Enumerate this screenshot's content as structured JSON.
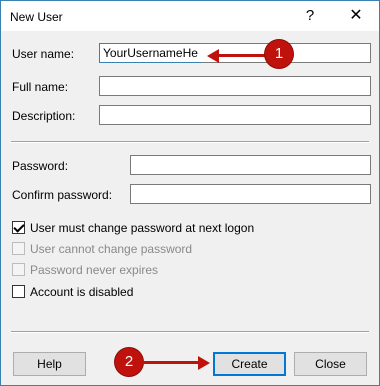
{
  "window": {
    "title": "New User",
    "help_glyph": "?",
    "close_glyph": "✕"
  },
  "form": {
    "username_label": "User name:",
    "username_value": "YourUsernameHere",
    "fullname_label": "Full name:",
    "fullname_value": "",
    "description_label": "Description:",
    "description_value": "",
    "password_label": "Password:",
    "password_value": "",
    "confirm_label": "Confirm password:",
    "confirm_value": ""
  },
  "options": [
    {
      "label": "User must change password at next logon",
      "checked": true,
      "enabled": true
    },
    {
      "label": "User cannot change password",
      "checked": false,
      "enabled": false
    },
    {
      "label": "Password never expires",
      "checked": false,
      "enabled": false
    },
    {
      "label": "Account is disabled",
      "checked": false,
      "enabled": true
    }
  ],
  "buttons": {
    "help": "Help",
    "create": "Create",
    "close": "Close"
  },
  "annotations": {
    "step1": "1",
    "step2": "2",
    "color": "#c0120c"
  }
}
